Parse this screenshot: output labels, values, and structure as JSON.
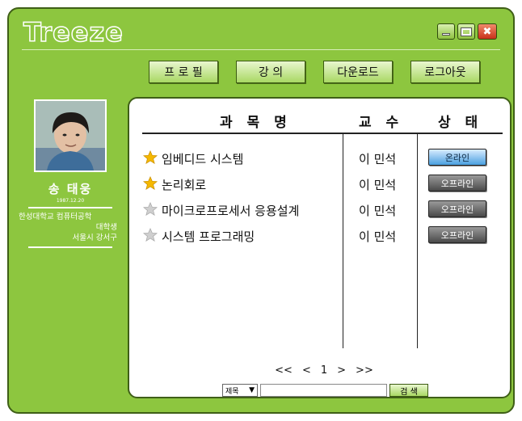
{
  "app": {
    "title": "Treeze"
  },
  "nav": [
    "프 로 필",
    "강  의",
    "다운로드",
    "로그아웃"
  ],
  "profile": {
    "name": "송 태웅",
    "birth": "1987.12.20",
    "school": "한성대학교 컴퓨터공학",
    "status": "대학생",
    "location": "서울시 강서구"
  },
  "table": {
    "headers": {
      "subject": "과 목 명",
      "professor": "교 수",
      "status": "상 태"
    },
    "rows": [
      {
        "subject": "임베디드 시스템",
        "professor": "이 민석",
        "status": "온라인",
        "online": true,
        "starred": true
      },
      {
        "subject": "논리회로",
        "professor": "이 민석",
        "status": "오프라인",
        "online": false,
        "starred": true
      },
      {
        "subject": "마이크로프로세서 응용설계",
        "professor": "이 민석",
        "status": "오프라인",
        "online": false,
        "starred": false
      },
      {
        "subject": "시스템 프로그래밍",
        "professor": "이 민석",
        "status": "오프라인",
        "online": false,
        "starred": false
      }
    ]
  },
  "pager": {
    "first": "<<",
    "prev": "<",
    "page": "1",
    "next": ">",
    "last": ">>"
  },
  "search": {
    "field": "제목",
    "arrow": "▼",
    "value": "",
    "button": "검 색"
  },
  "colors": {
    "frame": "#8dc63f",
    "online": "#4aa0e0",
    "offline": "#4a4a4a",
    "star_on": "#f5b800",
    "star_off": "#cfcfcf"
  }
}
